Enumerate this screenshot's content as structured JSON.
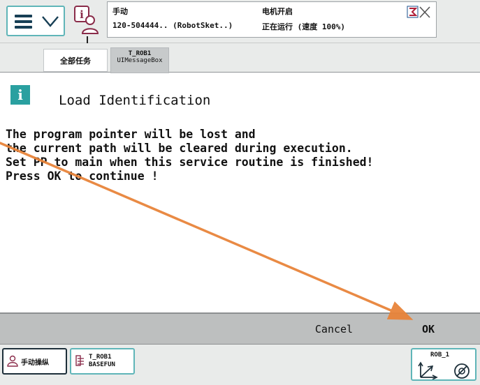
{
  "header": {
    "status": {
      "mode": "手动",
      "controller": "120-504444.. (RobotSket..)",
      "motors": "电机开启",
      "run_state": "正在运行 (速度 100%)"
    }
  },
  "tabs": [
    {
      "label": "全部任务"
    },
    {
      "line1": "T_ROB1",
      "line2": "UIMessageBox"
    }
  ],
  "message": {
    "title": "Load Identification",
    "lines": [
      "The program pointer will be lost and",
      "the current path will be cleared during execution.",
      "Set PP to main when this service routine is finished!",
      "Press OK to continue !"
    ]
  },
  "buttons": {
    "cancel": "Cancel",
    "ok": "OK"
  },
  "taskbar": {
    "jog_label": "手动操纵",
    "task_line1": "T_ROB1",
    "task_line2": "BASEFUN",
    "robot_label": "ROB_1"
  },
  "colors": {
    "accent": "#5fb5b8",
    "info_icon": "#2aa0a0",
    "annotation_arrow": "#e8843a",
    "button_bar": "#bdbfbf"
  },
  "icons": [
    "menu-icon",
    "chevron-down-icon",
    "event-log-icon",
    "close-icon",
    "info-icon",
    "jog-icon",
    "task-icon",
    "coordinate-system-icon",
    "speed-icon"
  ]
}
